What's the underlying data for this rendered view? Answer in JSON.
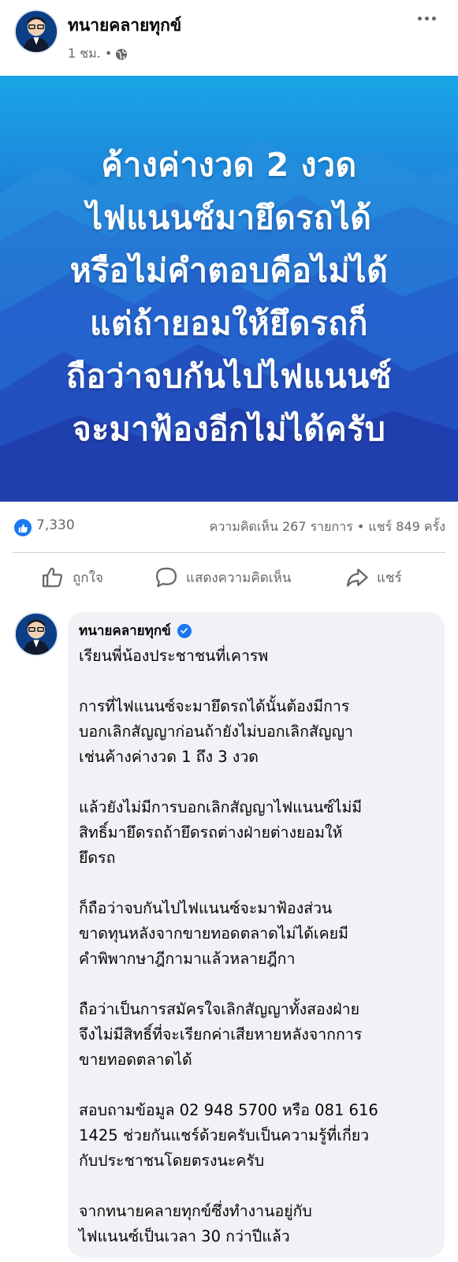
{
  "post": {
    "author_name": "ทนายคลายทุกข์",
    "timestamp": "1 ชม. •",
    "privacy_icon": "globe-icon",
    "more_icon": "more-options-icon",
    "avatar_label": "ทนายคลายทุกข์"
  },
  "banner": {
    "lines": [
      "ค้างค่างวด 2 งวด",
      "ไฟแนนซ์มายึดรถได้",
      "หรือไม่คำตอบคือไม่ได้",
      "แต่ถ้ายอมให้ยึดรถก็",
      "ถือว่าจบกันไปไฟแนนซ์",
      "จะมาฟ้องอีกไม่ได้ครับ"
    ],
    "colors": {
      "top": "#1aa6e6",
      "bottom": "#233fb3"
    }
  },
  "stats": {
    "like_count": "7,330",
    "summary": "ความคิดเห็น 267 รายการ • แชร์ 849 ครั้ง"
  },
  "actions": {
    "like_label": "ถูกใจ",
    "comment_label": "แสดงความคิดเห็น",
    "share_label": "แชร์"
  },
  "comment": {
    "author_name": "ทนายคลายทุกข์",
    "verified": true,
    "paragraphs": [
      [
        "เรียนพี่น้องประชาชนที่เคารพ"
      ],
      [
        "การที่ไฟแนนซ์จะมายึดรถได้นั้นต้องมีการ",
        "บอกเลิกสัญญาก่อนถ้ายังไม่บอกเลิกสัญญา",
        "เช่นค้างค่างวด 1 ถึง 3 งวด"
      ],
      [
        "แล้วยังไม่มีการบอกเลิกสัญญาไฟแนนซ์ไม่มี",
        "สิทธิ์มายึดรถถ้ายึดรถต่างฝ่ายต่างยอมให้",
        "ยึดรถ"
      ],
      [
        "ก็ถือว่าจบกันไปไฟแนนซ์จะมาฟ้องส่วน",
        "ขาดทุนหลังจากขายทอดตลาดไม่ได้เคยมี",
        "คำพิพากษาฎีกามาแล้วหลายฎีกา"
      ],
      [
        "ถือว่าเป็นการสมัครใจเลิกสัญญาทั้งสองฝ่าย",
        "จึงไม่มีสิทธิ์ที่จะเรียกค่าเสียหายหลังจากการ",
        "ขายทอดตลาดได้"
      ],
      [
        "สอบถามข้อมูล 02 948 5700 หรือ 081 616",
        "1425 ช่วยกันแชร์ด้วยครับเป็นความรู้ที่เกี่ยว",
        "กับประชาชนโดยตรงนะครับ"
      ],
      [
        "จากทนายคลายทุกข์ซึ่งทำงานอยู่กับ",
        "ไฟแนนซ์เป็นเวลา 30 กว่าปีแล้ว"
      ]
    ]
  },
  "colors": {
    "accent": "#1877f2",
    "muted_text": "#65676b",
    "bubble_bg": "#f0f2f5"
  }
}
